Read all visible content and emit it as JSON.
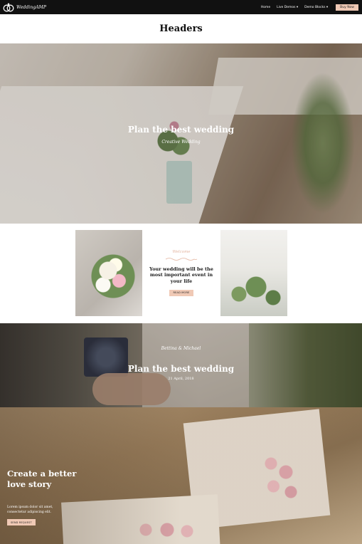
{
  "nav": {
    "brand": "WeddingAMP",
    "links": [
      "Home",
      "Live Demos ▾",
      "Demo Blocks ▾"
    ],
    "buy_label": "Buy Now"
  },
  "headers_title": "Headers",
  "hero1": {
    "title": "Plan the best wedding",
    "subtitle": "Creative Wedding"
  },
  "middle": {
    "welcome": "Welcome",
    "heading": "Your wedding will be the most important event in your life",
    "button": "READ MORE"
  },
  "hero2": {
    "names": "Bettina & Michael",
    "title": "Plan the best wedding",
    "date": "21 April, 2018"
  },
  "hero3": {
    "title": "Create a better love story",
    "text": "Lorem ipsum dolor sit amet, consectetur adipiscing elit.",
    "button": "SEND REQUEST"
  },
  "colors": {
    "accent": "#f0c9b5",
    "nav_bg": "#111111",
    "welcome": "#e4b5a0"
  }
}
